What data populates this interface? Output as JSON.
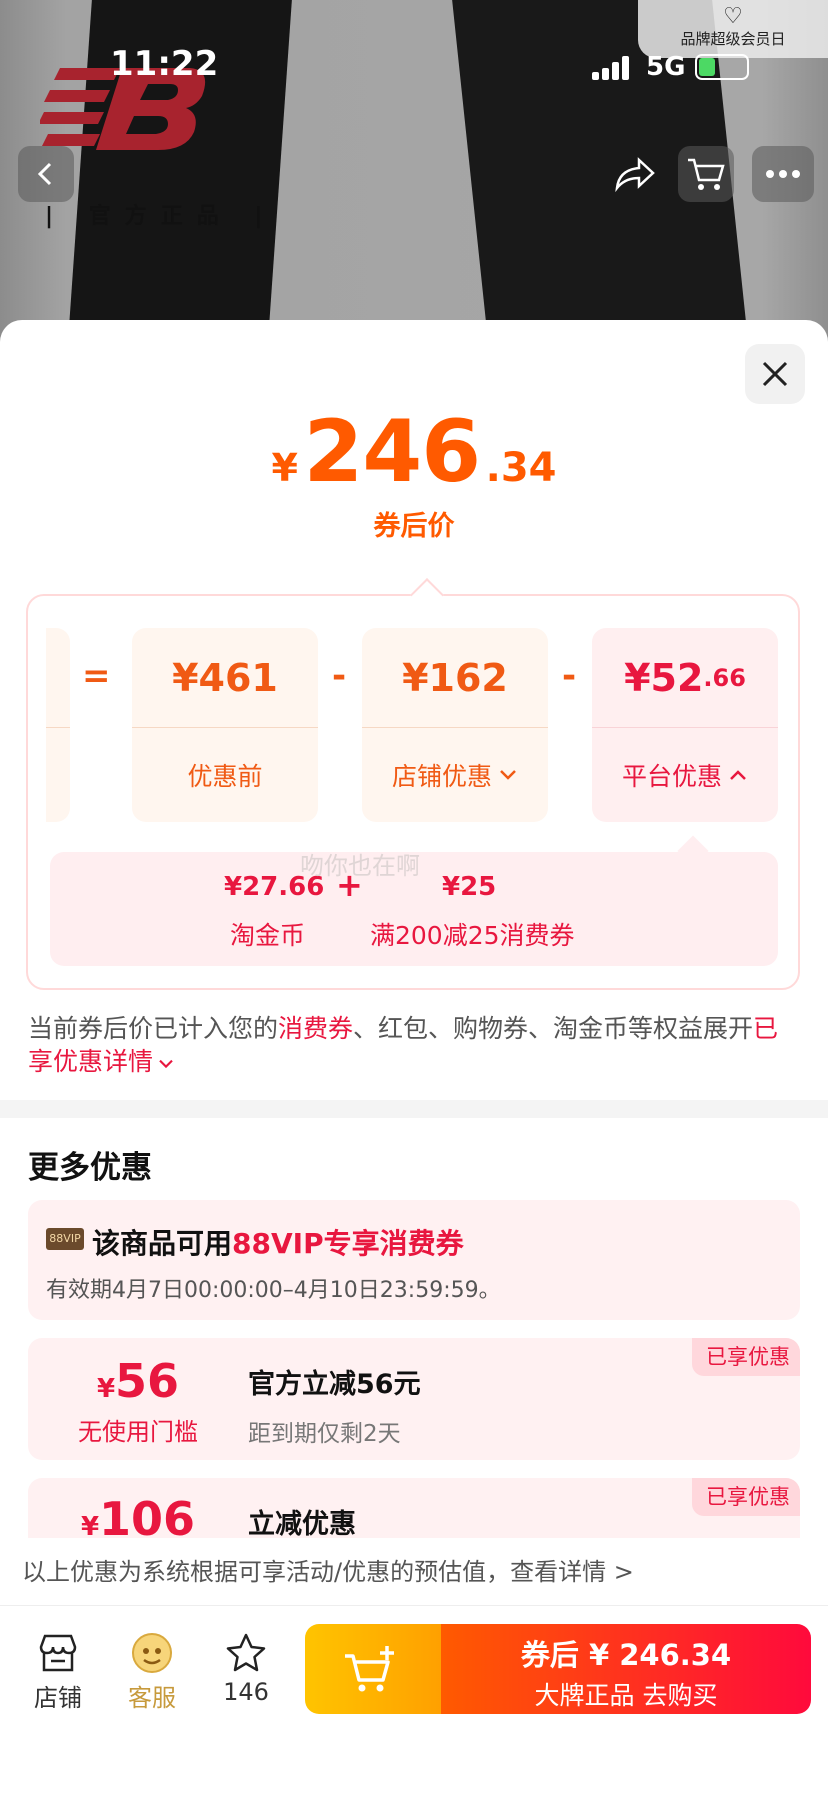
{
  "status_bar": {
    "time": "11:22",
    "network": "5G"
  },
  "banner": {
    "vip_badge": "品牌超级会员日",
    "official_label": "| 官方正品 |"
  },
  "nav": {
    "back_icon": "chevron-left-icon",
    "share_icon": "share-icon",
    "cart_icon": "cart-icon",
    "more_icon": "more-icon"
  },
  "price": {
    "symbol": "¥",
    "integer": "246",
    "decimal": ".34",
    "label": "券后价"
  },
  "breakdown": {
    "equals": "=",
    "minus": "-",
    "original": {
      "amount": "¥461",
      "label": "优惠前"
    },
    "store": {
      "amount": "¥162",
      "label": "店铺优惠"
    },
    "platform": {
      "amount_int": "¥52",
      "amount_dec": ".66",
      "label": "平台优惠"
    },
    "platform_detail": {
      "coin_amount": "¥27.66",
      "coin_label": "淘金币",
      "plus": "+",
      "coupon_amount": "¥25",
      "coupon_label": "满200减25消费券"
    },
    "watermark": "吻你也在啊"
  },
  "notice": {
    "part1": "当前券后价已计入您的",
    "highlight": "消费券",
    "part2": "、红包、购物券、淘金币等权益展开",
    "link": "已享优惠详情"
  },
  "more_offers": {
    "title": "更多优惠",
    "vip_coupon": {
      "badge": "88VIP",
      "prefix": "该商品可用",
      "highlight": "88VIP专享消费券",
      "validity": "有效期4月7日00:00:00–4月10日23:59:59。"
    },
    "coupons": [
      {
        "symbol": "¥",
        "amount": "56",
        "condition": "无使用门槛",
        "title": "官方立减56元",
        "desc": "距到期仅剩2天",
        "tag": "已享优惠"
      },
      {
        "symbol": "¥",
        "amount": "106",
        "title": "立减优惠",
        "tag": "已享优惠"
      }
    ]
  },
  "footer_note": "以上优惠为系统根据可享活动/优惠的预估值，查看详情 >",
  "bottom_bar": {
    "store": "店铺",
    "service": "客服",
    "favorites": "146",
    "buy_line1": "券后 ¥ 246.34",
    "buy_line2": "大牌正品 去购买"
  },
  "colors": {
    "orange": "#ff5a00",
    "red": "#e8173f",
    "gold": "#ffc400"
  }
}
